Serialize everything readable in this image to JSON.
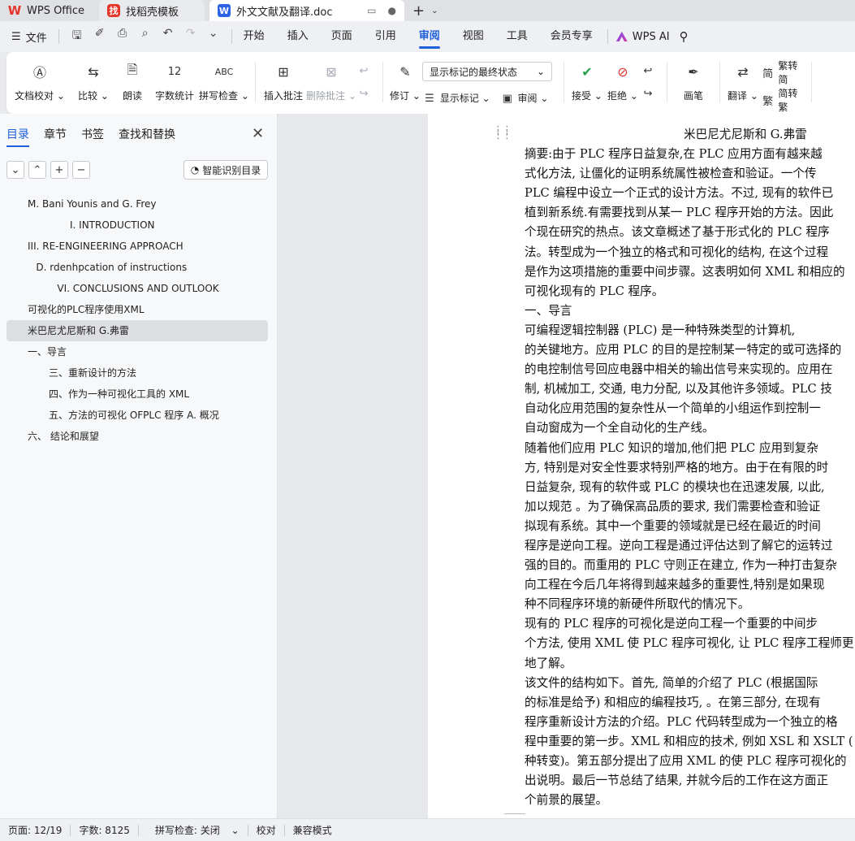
{
  "titlebar": {
    "app_tab": "WPS Office",
    "template_tab": "找稻壳模板",
    "doc_tab": "外文文献及翻译.doc"
  },
  "menu": {
    "file": "文件",
    "items": [
      "开始",
      "插入",
      "页面",
      "引用",
      "审阅",
      "视图",
      "工具",
      "会员专享"
    ],
    "active": "审阅",
    "ai": "WPS AI"
  },
  "ribbon": {
    "proofread": "文档校对",
    "compare": "比较",
    "read_aloud": "朗读",
    "word_count": "字数统计",
    "spell_check": "拼写检查",
    "insert_comment": "插入批注",
    "delete_comment": "删除批注",
    "revise": "修订",
    "markup_state": "显示标记的最终状态",
    "show_markup": "显示标记",
    "review": "审阅",
    "accept": "接受",
    "reject": "拒绝",
    "pen": "画笔",
    "translate": "翻译",
    "to_simplified": "繁转简",
    "to_traditional": "简转繁"
  },
  "leftpanel": {
    "tabs": [
      "目录",
      "章节",
      "书签",
      "查找和替换"
    ],
    "active_tab": "目录",
    "smart_toc": "智能识别目录",
    "toc": [
      {
        "text": "M. Bani Younis and G. Frey",
        "indent": 1,
        "selected": false
      },
      {
        "text": "I. INTRODUCTION",
        "indent": 3,
        "selected": false
      },
      {
        "text": "III. RE-ENGINEERING APPROACH",
        "indent": 1,
        "selected": false
      },
      {
        "text": "D. rdenhpcation of instructions",
        "indent": 1.4,
        "selected": false
      },
      {
        "text": "VI. CONCLUSIONS AND OUTLOOK",
        "indent": 2.4,
        "selected": false
      },
      {
        "text": "可视化的PLC程序使用XML",
        "indent": 1,
        "selected": false
      },
      {
        "text": "米巴尼尤尼斯和 G.弗雷",
        "indent": 1,
        "selected": true
      },
      {
        "text": "一、导言",
        "indent": 1,
        "selected": false
      },
      {
        "text": "三、重新设计的方法",
        "indent": 2,
        "selected": false
      },
      {
        "text": "四、作为一种可视化工具的 XML",
        "indent": 2,
        "selected": false
      },
      {
        "text": "五、方法的可视化 OFPLC 程序 A. 概况",
        "indent": 2,
        "selected": false
      },
      {
        "text": "六、  结论和展望",
        "indent": 1,
        "selected": false
      }
    ]
  },
  "document": {
    "lines": [
      "米巴尼尤尼斯和 G.弗雷",
      "    摘要:由于 PLC 程序日益复杂,在 PLC 应用方面有越来越",
      "式化方法, 让僵化的证明系统属性被检查和验证。一个传",
      "PLC 编程中设立一个正式的设计方法。不过, 现有的软件已",
      "植到新系统.有需要找到从某一 PLC 程序开始的方法。因此",
      "个现在研究的热点。该文章概述了基于形式化的 PLC 程序",
      "法。转型成为一个独立的格式和可视化的结构, 在这个过程",
      "是作为这项措施的重要中间步骤。这表明如何 XML 和相应的",
      "可视化现有的 PLC 程序。",
      "    一、导言",
      "    可编程逻辑控制器 (PLC) 是一种特殊类型的计算机,",
      "的关键地方。应用 PLC 的目的是控制某一特定的或可选择的",
      "的电控制信号回应电器中相关的输出信号来实现的。应用在",
      "制, 机械加工, 交通, 电力分配, 以及其他许多领域。PLC 技",
      "自动化应用范围的复杂性从一个简单的小组运作到控制一",
      "自动窗成为一个全自动化的生产线。",
      "    随着他们应用 PLC 知识的增加,他们把 PLC 应用到复杂",
      "方, 特别是对安全性要求特别严格的地方。由于在有限的时",
      "日益复杂, 现有的软件或 PLC 的模块也在迅速发展, 以此,",
      "加以规范 。为了确保高品质的要求, 我们需要检查和验证",
      "拟现有系统。其中一个重要的领域就是已经在最近的时间",
      "程序是逆向工程。逆向工程是通过评估达到了解它的运转过",
      "强的目的。而重用的 PLC 守则正在建立, 作为一种打击复杂",
      "向工程在今后几年将得到越来越多的重要性,特别是如果现",
      "种不同程序环境的新硬件所取代的情况下。",
      "    现有的 PLC 程序的可视化是逆向工程一个重要的中间步",
      "个方法, 使用 XML 使 PLC 程序可视化, 让 PLC 程序工程师更",
      "地了解。",
      "    该文件的结构如下。首先, 简单的介绍了 PLC (根据国际",
      "的标准是给予) 和相应的编程技巧, 。在第三部分, 在现有",
      "程序重新设计方法的介绍。PLC 代码转型成为一个独立的格",
      "程中重要的第一步。XML 和相应的技术, 例如 XSL 和 XSLT (",
      "种转变)。第五部分提出了应用 XML 的使 PLC 程序可视化的",
      "出说明。最后一节总结了结果, 并就今后的工作在这方面正",
      "个前景的展望。"
    ]
  },
  "status": {
    "page": "页面: 12/19",
    "words": "字数: 8125",
    "spell": "拼写检查: 关闭",
    "proof": "校对",
    "compat": "兼容模式"
  }
}
